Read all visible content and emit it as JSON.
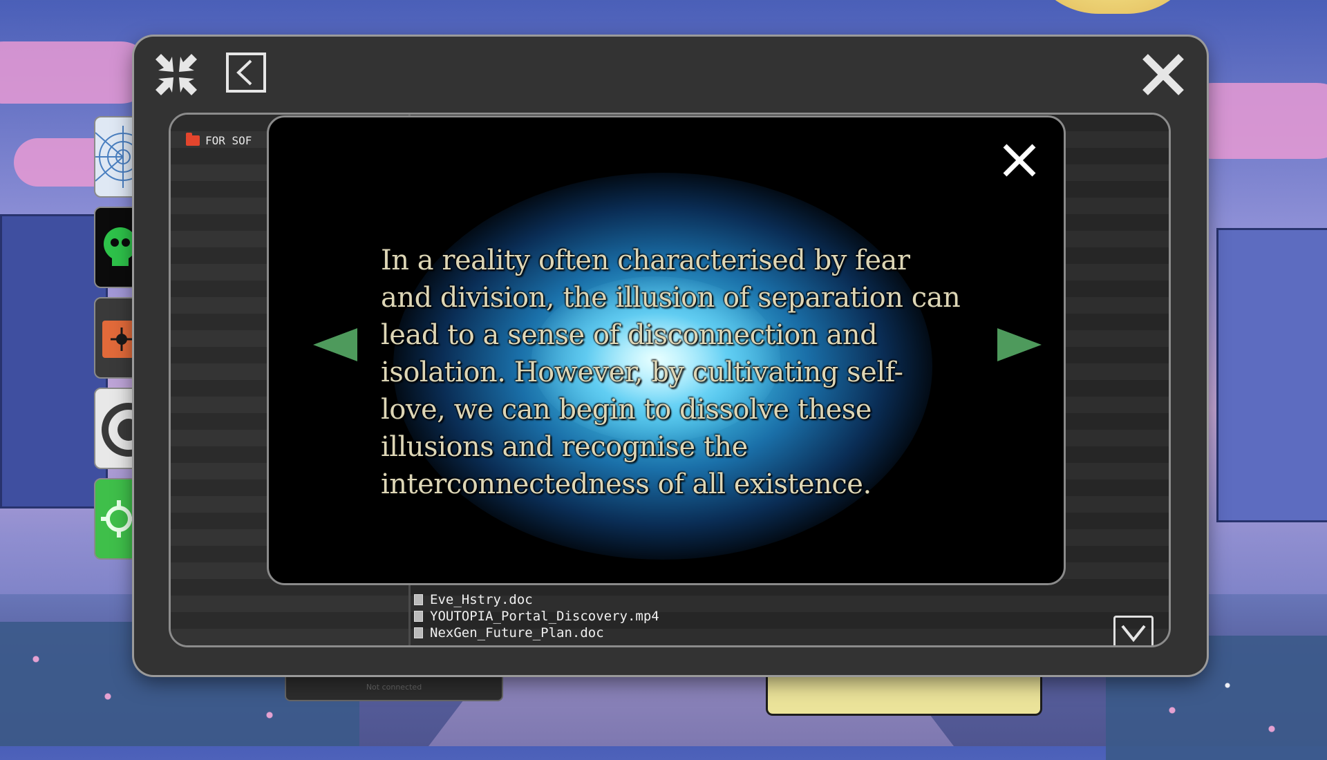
{
  "window": {
    "collapse_icon": "collapse-arrows-icon",
    "back_icon": "back-chevron-icon",
    "close_icon": "close-x-icon"
  },
  "sidebar": {
    "folder_label": "FOR SOF",
    "folder_icon": "folder-icon"
  },
  "files": [
    {
      "name": "Eve_Hstry.doc",
      "icon": "document-icon"
    },
    {
      "name": "YOUTOPIA_Portal_Discovery.mp4",
      "icon": "document-icon"
    },
    {
      "name": "NexGen_Future_Plan.doc",
      "icon": "document-icon"
    }
  ],
  "modal": {
    "quote": "In a reality often characterised by fear and division, the illusion of separation can lead to a sense of disconnection and isolation. However, by cultivating self-love, we can begin to dissolve these illusions and recognise the interconnectedness of all existence.",
    "prev_icon": "arrow-left-icon",
    "next_icon": "arrow-right-icon",
    "close_icon": "close-x-icon"
  },
  "background_widget": {
    "status_text": "Not connected"
  },
  "dock": [
    {
      "icon": "spiderweb-icon",
      "color": "#dfe8f4"
    },
    {
      "icon": "green-skull-icon",
      "color": "#0b0b0b"
    },
    {
      "icon": "orange-virus-icon",
      "color": "#e26a3a"
    },
    {
      "icon": "gray-ring-icon",
      "color": "#e8e8e8"
    },
    {
      "icon": "gear-icon",
      "color": "#3fbf4a"
    }
  ],
  "colors": {
    "window_bg": "#333333",
    "modal_bg": "#000000",
    "arrow_green": "#4e9a5c",
    "quote_text": "#ddd6b6",
    "glow_blue": "#3fb8e0"
  }
}
